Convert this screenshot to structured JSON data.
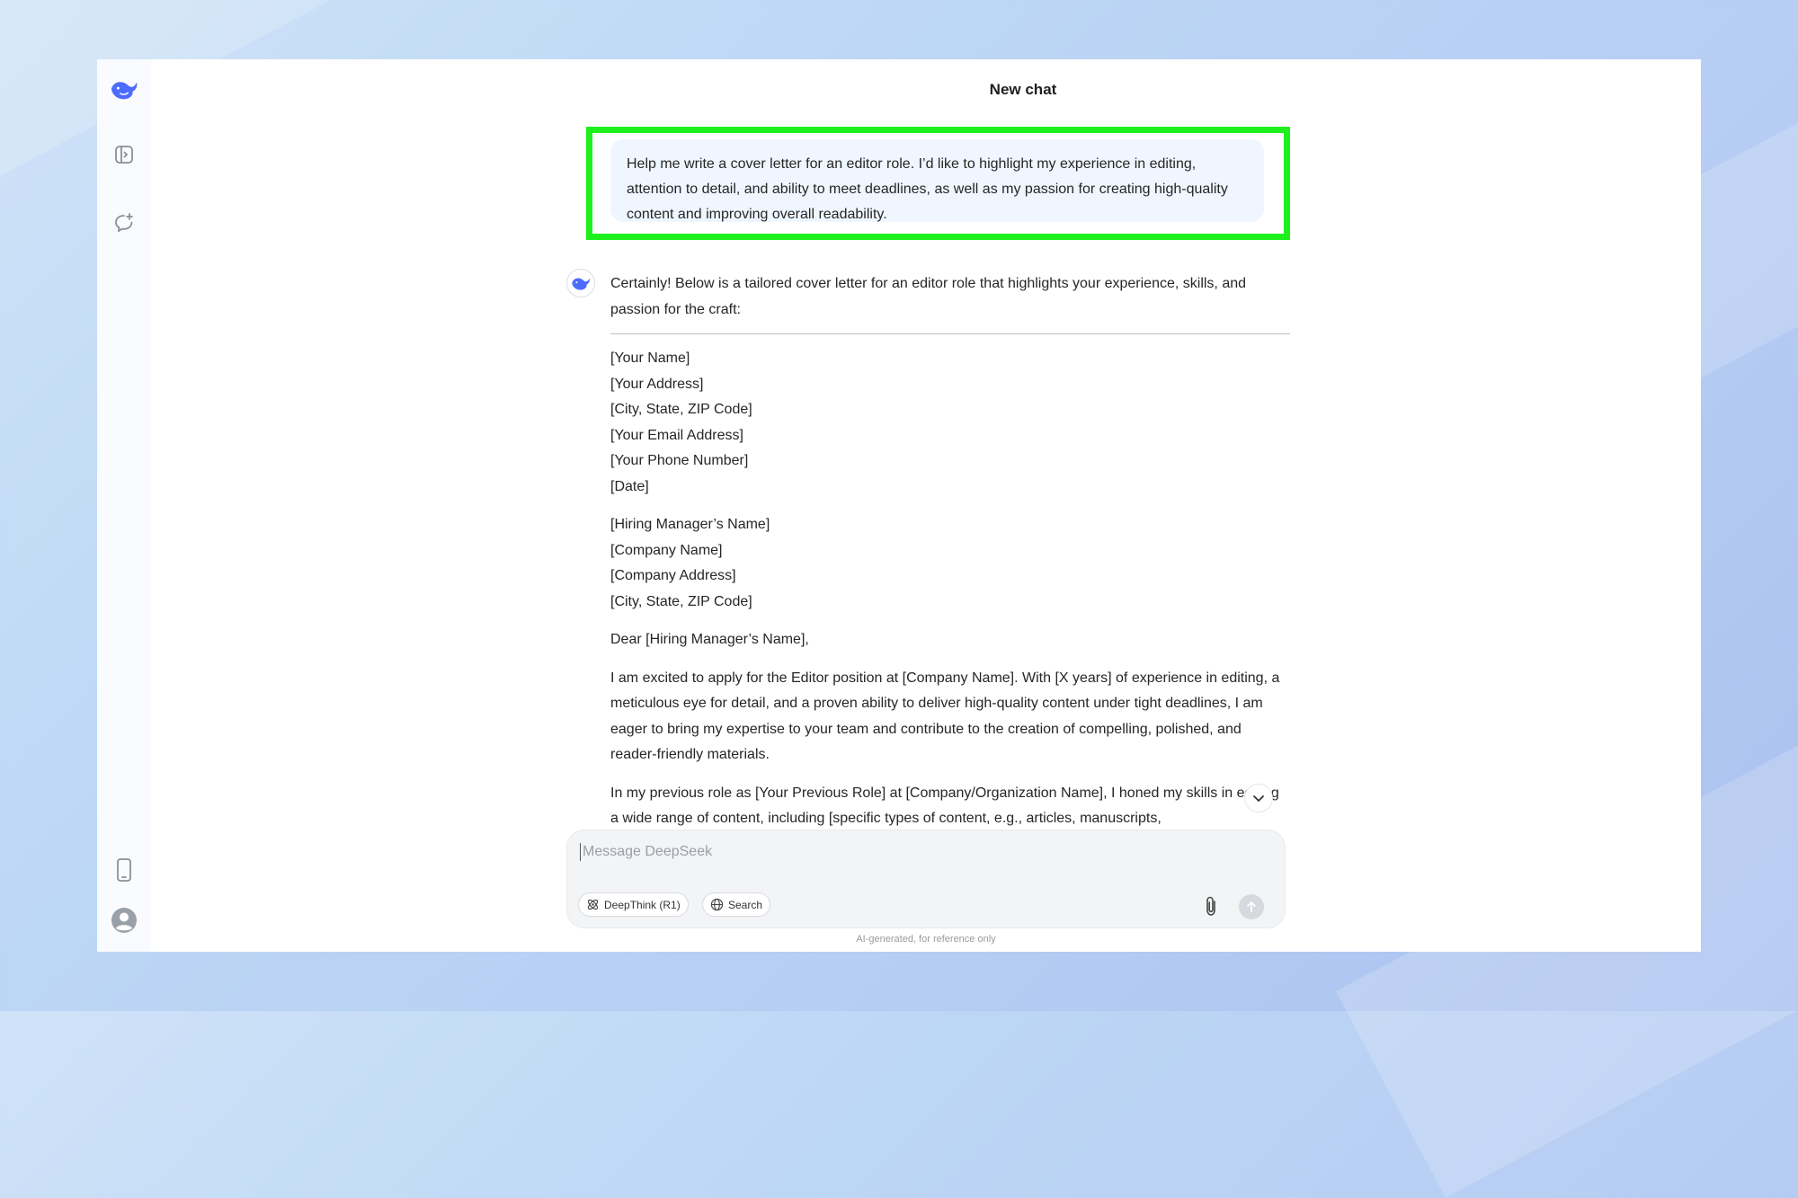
{
  "window": {
    "title": "New chat"
  },
  "sidebar": {
    "icons": [
      "deepseek-logo",
      "open-sidebar-icon",
      "new-chat-icon",
      "mobile-app-icon",
      "profile-icon"
    ]
  },
  "user_message": "Help me write a cover letter for an editor role. I’d like to highlight my experience in editing, attention to detail, and ability to meet deadlines, as well as my passion for creating high-quality content and improving overall readability.",
  "answer": {
    "intro": "Certainly! Below is a tailored cover letter for an editor role that highlights your experience, skills, and passion for the craft:",
    "sender": [
      "[Your Name]",
      "[Your Address]",
      "[City, State, ZIP Code]",
      "[Your Email Address]",
      "[Your Phone Number]",
      "[Date]"
    ],
    "recipient": [
      "[Hiring Manager’s Name]",
      "[Company Name]",
      "[Company Address]",
      "[City, State, ZIP Code]"
    ],
    "salutation": "Dear [Hiring Manager’s Name],",
    "paragraph1": "I am excited to apply for the Editor position at [Company Name]. With [X years] of experience in editing, a meticulous eye for detail, and a proven ability to deliver high-quality content under tight deadlines, I am eager to bring my expertise to your team and contribute to the creation of compelling, polished, and reader-friendly materials.",
    "paragraph2": "In my previous role as [Your Previous Role] at [Company/Organization Name], I honed my skills in editing a wide range of content, including [specific types of content, e.g., articles, manuscripts,"
  },
  "composer": {
    "placeholder": "Message DeepSeek",
    "deepthink_label": "DeepThink (R1)",
    "search_label": "Search"
  },
  "footnote": "AI-generated, for reference only",
  "colors": {
    "accent": "#4d6bfe",
    "highlight": "#1ef01e",
    "user_bubble": "#eff6ff"
  }
}
